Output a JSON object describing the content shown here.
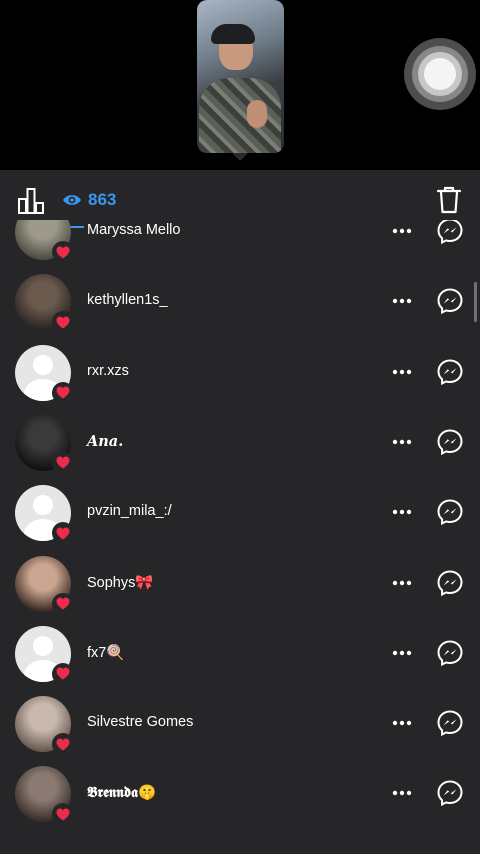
{
  "story": {
    "preview_label": "Story preview"
  },
  "header": {
    "view_count": "863",
    "icons": {
      "stats": "bar-chart-icon",
      "views": "eye-icon",
      "delete": "trash-icon"
    },
    "accent_color": "#3897f0"
  },
  "viewers": [
    {
      "username": "Maryssa Mello",
      "avatar": "photo",
      "avatar_colors": [
        "#9e9a8a",
        "#4f4c44"
      ],
      "style": "normal"
    },
    {
      "username": "kethyllen1s_",
      "avatar": "photo",
      "avatar_colors": [
        "#6b5a4e",
        "#2c2522"
      ],
      "style": "normal"
    },
    {
      "username": "rxr.xzs",
      "avatar": "default",
      "style": "normal"
    },
    {
      "username": "𝑨𝒏𝒂.",
      "avatar": "photo",
      "avatar_colors": [
        "#3a3a3a",
        "#111111"
      ],
      "style": "italic"
    },
    {
      "username": "pvzin_mila_:/",
      "avatar": "default",
      "style": "normal"
    },
    {
      "username": "Sophys🎀",
      "avatar": "photo",
      "avatar_colors": [
        "#caa58f",
        "#3d2c25"
      ],
      "style": "normal"
    },
    {
      "username": "fx7🍭",
      "avatar": "default",
      "style": "normal"
    },
    {
      "username": "Silvestre Gomes",
      "avatar": "photo",
      "avatar_colors": [
        "#c9b8ad",
        "#6a5a52"
      ],
      "style": "normal"
    },
    {
      "username": "𝕭𝖗𝖊𝖓𝖓𝖉𝖆🤫",
      "avatar": "photo",
      "avatar_colors": [
        "#8b7a72",
        "#3a2f2b"
      ],
      "style": "gothic"
    }
  ],
  "row_icons": {
    "more": "more-dots-icon",
    "message": "messenger-icon",
    "badge": "heart-icon"
  },
  "badge_color": "#ed2b4b"
}
